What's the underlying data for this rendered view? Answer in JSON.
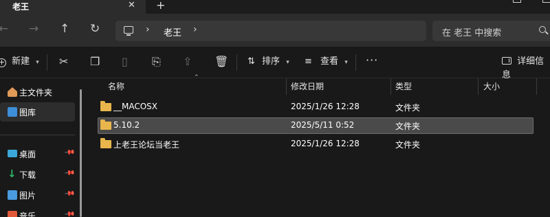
{
  "tab": {
    "title": "老王",
    "close_glyph": "✕",
    "new_glyph": "+"
  },
  "nav": {
    "back": "←",
    "forward": "→",
    "up": "↑",
    "refresh": "↻",
    "address": {
      "chevron": "›",
      "folder": "老王",
      "trail_chevron": "›"
    },
    "search_placeholder": "在 老王 中搜索"
  },
  "toolbar": {
    "new_label": "新建",
    "sort_label": "排序",
    "view_label": "查看",
    "more_glyph": "···",
    "details_label": "详细信息"
  },
  "sidebar": {
    "items": [
      {
        "label": "主文件夹",
        "icon": "home-icon",
        "color": "#e09a58",
        "pinned": false
      },
      {
        "label": "图库",
        "icon": "gallery-icon",
        "color": "#3d8fd9",
        "pinned": false
      },
      {
        "label": "桌面",
        "icon": "desktop-icon",
        "color": "#3aa7d8",
        "pinned": true
      },
      {
        "label": "下载",
        "icon": "download-icon",
        "color": "#2fb86b",
        "pinned": true
      },
      {
        "label": "图片",
        "icon": "pictures-icon",
        "color": "#4a9be0",
        "pinned": true
      },
      {
        "label": "音乐",
        "icon": "music-icon",
        "color": "#e0593a",
        "pinned": true
      }
    ]
  },
  "columns": {
    "name": "名称",
    "modified": "修改日期",
    "type": "类型",
    "size": "大小"
  },
  "files": [
    {
      "name": "__MACOSX",
      "modified": "2025/1/26 12:28",
      "type": "文件夹",
      "size": ""
    },
    {
      "name": "5.10.2",
      "modified": "2025/5/11 0:52",
      "type": "文件夹",
      "size": ""
    },
    {
      "name": "上老王论坛当老王",
      "modified": "2025/1/26 12:28",
      "type": "文件夹",
      "size": ""
    }
  ],
  "selected_index": 1,
  "colors": {
    "folder": "#e8b64c",
    "background": "#191919",
    "selection": "#4a4a4a"
  }
}
